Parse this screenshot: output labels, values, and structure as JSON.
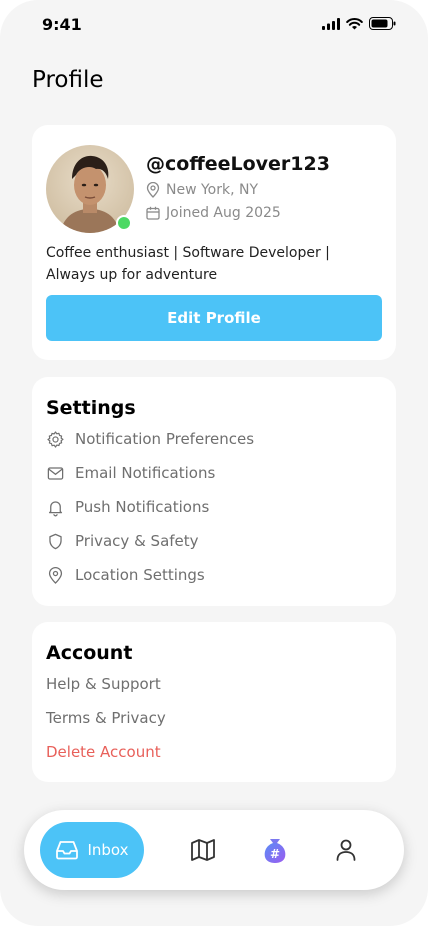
{
  "status_bar": {
    "time": "9:41"
  },
  "page": {
    "title": "Profile"
  },
  "profile": {
    "username": "@coffeeLover123",
    "location": "New York, NY",
    "joined": "Joined Aug 2025",
    "bio": "Coffee enthusiast |  Software Developer | Always up for adventure",
    "edit_label": "Edit Profile",
    "online_color": "#4cd964"
  },
  "settings": {
    "title": "Settings",
    "items": [
      {
        "label": "Notification Preferences",
        "icon": "gear-icon"
      },
      {
        "label": "Email Notifications",
        "icon": "mail-icon"
      },
      {
        "label": "Push Notifications",
        "icon": "bell-icon"
      },
      {
        "label": "Privacy & Safety",
        "icon": "shield-icon"
      },
      {
        "label": "Location Settings",
        "icon": "location-pin-icon"
      }
    ]
  },
  "account": {
    "title": "Account",
    "items": [
      {
        "label": "Help & Support"
      },
      {
        "label": "Terms & Privacy"
      },
      {
        "label": "Delete Account",
        "color": "#e8605a"
      }
    ]
  },
  "bottom_nav": {
    "inbox_label": "Inbox",
    "accent": "#4cc3f7",
    "items": [
      "inbox-icon",
      "map-icon",
      "hashtag-bag-icon",
      "user-icon"
    ]
  }
}
